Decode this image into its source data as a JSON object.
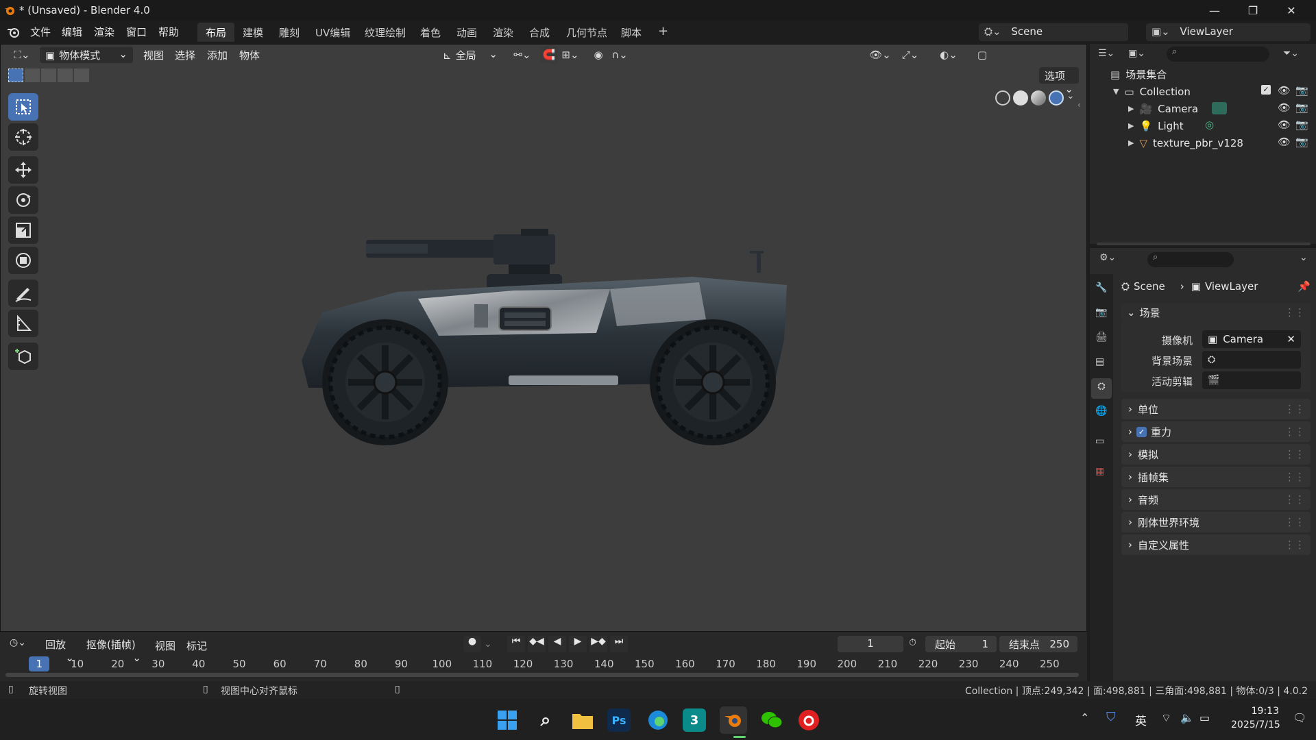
{
  "app": {
    "title": "* (Unsaved) - Blender 4.0"
  },
  "menu": {
    "file": "文件",
    "edit": "编辑",
    "render": "渲染",
    "window": "窗口",
    "help": "帮助"
  },
  "workspaces": [
    "布局",
    "建模",
    "雕刻",
    "UV编辑",
    "纹理绘制",
    "着色",
    "动画",
    "渲染",
    "合成",
    "几何节点",
    "脚本"
  ],
  "workspace_active": "布局",
  "scene_selector": {
    "scene": "Scene",
    "view_layer": "ViewLayer"
  },
  "viewport_header": {
    "mode": "物体模式",
    "view": "视图",
    "select": "选择",
    "add": "添加",
    "object": "物体",
    "transform_orientation": "全局",
    "options": "选项"
  },
  "toolbar": {
    "tools": [
      "select-box-icon",
      "cursor-icon",
      "move-icon",
      "rotate-icon",
      "scale-icon",
      "transform-icon",
      "annotate-icon",
      "measure-icon",
      "add-cube-icon"
    ]
  },
  "outliner": {
    "root": "场景集合",
    "collection": "Collection",
    "items": [
      "Camera",
      "Light",
      "texture_pbr_v128"
    ]
  },
  "properties": {
    "breadcrumb_scene": "Scene",
    "breadcrumb_layer": "ViewLayer",
    "section_scene": "场景",
    "camera_label": "摄像机",
    "camera_value": "Camera",
    "background_label": "背景场景",
    "clip_label": "活动剪辑",
    "panels": [
      "单位",
      "重力",
      "模拟",
      "插帧集",
      "音频",
      "刚体世界环境",
      "自定义属性"
    ],
    "gravity_checked": true
  },
  "timeline": {
    "playback": "回放",
    "keying": "抠像(插帧)",
    "view": "视图",
    "marker": "标记",
    "current_frame": "1",
    "start_label": "起始",
    "start": "1",
    "end_label": "结束点",
    "end": "250",
    "ticks": [
      "1",
      "10",
      "20",
      "30",
      "40",
      "50",
      "60",
      "70",
      "80",
      "90",
      "100",
      "110",
      "120",
      "130",
      "140",
      "150",
      "160",
      "170",
      "180",
      "190",
      "200",
      "210",
      "220",
      "230",
      "240",
      "250"
    ]
  },
  "status": {
    "left1": "旋转视图",
    "left2": "视图中心对齐鼠标",
    "stats": "Collection | 顶点:249,342 | 面:498,881 | 三角面:498,881 | 物体:0/3 | 4.0.2"
  },
  "taskbar": {
    "time": "19:13",
    "date": "2025/7/15",
    "ime": "英"
  }
}
